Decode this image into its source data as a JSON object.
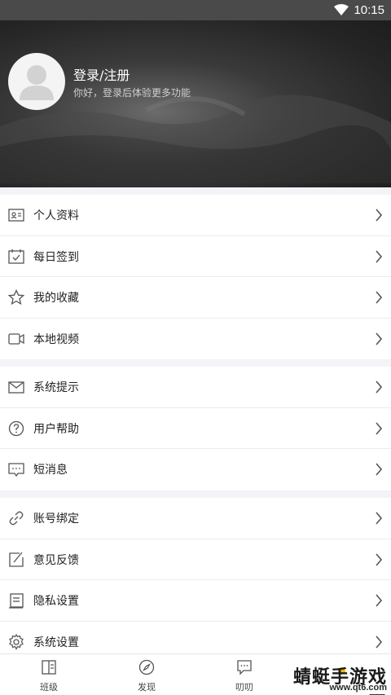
{
  "status_bar": {
    "time": "10:15",
    "wifi_icon": "wifi-icon"
  },
  "header": {
    "avatar_icon": "default-avatar-icon",
    "login_title": "登录/注册",
    "login_subtitle": "你好，登录后体验更多功能"
  },
  "menu_groups": [
    {
      "items": [
        {
          "label": "个人资料",
          "icon": "id-card-icon"
        },
        {
          "label": "每日签到",
          "icon": "calendar-check-icon"
        },
        {
          "label": "我的收藏",
          "icon": "star-icon"
        },
        {
          "label": "本地视频",
          "icon": "video-camera-icon"
        }
      ]
    },
    {
      "items": [
        {
          "label": "系统提示",
          "icon": "envelope-icon"
        },
        {
          "label": "用户帮助",
          "icon": "help-circle-icon"
        },
        {
          "label": "短消息",
          "icon": "message-icon"
        }
      ]
    },
    {
      "items": [
        {
          "label": "账号绑定",
          "icon": "link-icon"
        },
        {
          "label": "意见反馈",
          "icon": "edit-icon"
        },
        {
          "label": "隐私设置",
          "icon": "privacy-doc-icon"
        },
        {
          "label": "系统设置",
          "icon": "gear-icon"
        }
      ]
    }
  ],
  "tab_bar": {
    "tabs": [
      {
        "label": "班级",
        "icon": "class-book-icon"
      },
      {
        "label": "发现",
        "icon": "compass-icon"
      },
      {
        "label": "叨叨",
        "icon": "chat-bubble-icon"
      },
      {
        "label": "",
        "icon": ""
      }
    ]
  },
  "watermark": {
    "text": "蜻蜓手游戏网",
    "url": "www.qt6.com"
  },
  "colors": {
    "header_bg": "#2a2a2a",
    "statusbar_bg": "#4a4a4a",
    "divider_bg": "#f3f4f8",
    "watermark_dot": "#f5b400"
  }
}
